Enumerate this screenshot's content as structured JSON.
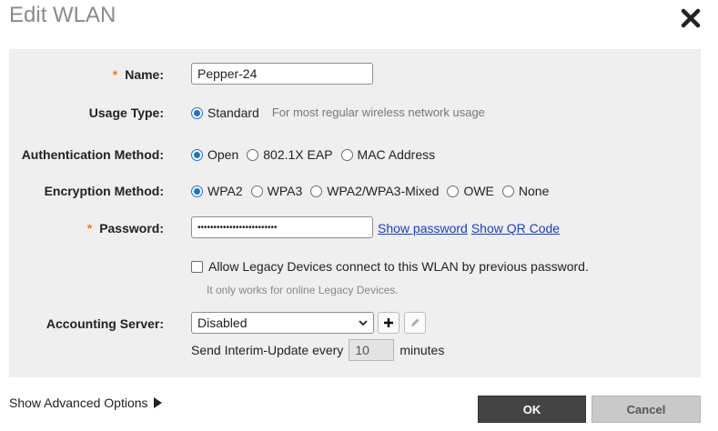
{
  "dialog": {
    "title": "Edit WLAN"
  },
  "form": {
    "name": {
      "required_mark": "*",
      "label": "Name:",
      "value": "Pepper-24"
    },
    "usage_type": {
      "label": "Usage Type:",
      "option": "Standard",
      "hint": "For most regular wireless network usage"
    },
    "auth_method": {
      "label": "Authentication Method:",
      "options": [
        "Open",
        "802.1X EAP",
        "MAC Address"
      ],
      "selected": "Open"
    },
    "encryption": {
      "label": "Encryption Method:",
      "options": [
        "WPA2",
        "WPA3",
        "WPA2/WPA3-Mixed",
        "OWE",
        "None"
      ],
      "selected": "WPA2"
    },
    "password": {
      "required_mark": "*",
      "label": "Password:",
      "masked_value": "•••••••••••••••••••••••••",
      "show_password": "Show password",
      "show_qr": "Show QR Code"
    },
    "legacy": {
      "label": "Allow Legacy Devices connect to this WLAN by previous password.",
      "note": "It only works for online Legacy Devices."
    },
    "accounting": {
      "label": "Accounting Server:",
      "value": "Disabled",
      "interim_prefix": "Send Interim-Update every",
      "interim_value": "10",
      "interim_suffix": "minutes"
    }
  },
  "footer": {
    "advanced": "Show Advanced Options",
    "ok": "OK",
    "cancel": "Cancel"
  },
  "icons": {
    "close": "close-x-icon",
    "chevron": "chevron-down-icon",
    "add": "plus-icon",
    "edit": "pencil-icon",
    "advanced": "triangle-right-icon"
  },
  "colors": {
    "accent": "#1a73d9",
    "required": "#f07d1a",
    "link": "#1a3fc4",
    "ok_bg": "#444444",
    "cancel_bg": "#c9c9c9",
    "panel_bg": "#efefef"
  }
}
